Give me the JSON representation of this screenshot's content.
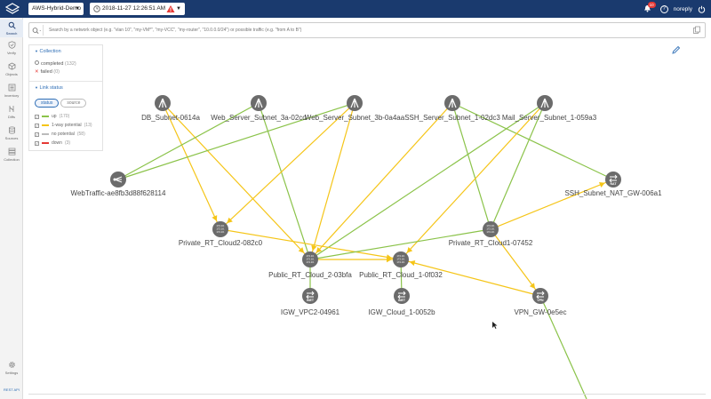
{
  "app": {
    "env_select": "AWS-Hybrid-Demo",
    "datetime": "2018-11-27 12:26:51 AM",
    "notifications": "10",
    "help": "?",
    "user": "noreply"
  },
  "sidebar": {
    "items": [
      {
        "label": "Search",
        "icon": "search-icon"
      },
      {
        "label": "Verify",
        "icon": "check-shield-icon"
      },
      {
        "label": "Objects",
        "icon": "cube-icon"
      },
      {
        "label": "Inventory",
        "icon": "list-icon"
      },
      {
        "label": "Diffs",
        "icon": "diff-icon"
      },
      {
        "label": "Sources",
        "icon": "database-icon"
      },
      {
        "label": "Collection",
        "icon": "collection-icon"
      },
      {
        "label": "Settings",
        "icon": "gear-icon"
      }
    ],
    "footer": "REST API"
  },
  "search": {
    "placeholder": "Search by a network object (e.g. \"vlan 10\", \"my-VM*\", \"my-VCC\", \"my-router\", \"10.0.0.0/24\") or possible traffic (e.g. \"from A to B\")"
  },
  "panel": {
    "collection_header": "Collection",
    "completed": "completed",
    "completed_count": "(132)",
    "failed": "failed",
    "failed_count": "(0)",
    "link_header": "Link status",
    "toggle_status": "status",
    "toggle_source": "source",
    "statuses": [
      {
        "label": "up",
        "count": "(170)",
        "color": "#8bc34a"
      },
      {
        "label": "1-way potential",
        "count": "(13)",
        "color": "#f5c518"
      },
      {
        "label": "no potential",
        "count": "(58)",
        "color": "#bbbbbb"
      },
      {
        "label": "down",
        "count": "(3)",
        "color": "#e53935"
      }
    ]
  },
  "topology": {
    "nodes": [
      {
        "id": "db",
        "label": "DB_Subnet-0614a",
        "type": "subnet"
      },
      {
        "id": "web3a",
        "label": "Web_Server_Subnet_3a-02cd",
        "type": "subnet"
      },
      {
        "id": "web3b",
        "label": "Web_Server_Subnet_3b-0a4aa",
        "type": "subnet"
      },
      {
        "id": "ssh",
        "label": "SSH_Server_Subnet_1-02dc3",
        "type": "subnet"
      },
      {
        "id": "mail",
        "label": "Mail_Server_Subnet_1-059a3",
        "type": "subnet"
      },
      {
        "id": "webtraffic",
        "label": "WebTraffic-ae8fb3d88f628114",
        "type": "traffic"
      },
      {
        "id": "sshnat",
        "label": "SSH_Subnet_NAT_GW-006a1",
        "type": "nat",
        "badge": "NAT"
      },
      {
        "id": "prt2",
        "label": "Private_RT_Cloud2-082c0",
        "type": "router"
      },
      {
        "id": "prt1",
        "label": "Private_RT_Cloud1-07452",
        "type": "router"
      },
      {
        "id": "pub2",
        "label": "Public_RT_Cloud_2-03bfa",
        "type": "router"
      },
      {
        "id": "pub1",
        "label": "Public_RT_Cloud_1-0f032",
        "type": "router"
      },
      {
        "id": "igw2",
        "label": "IGW_VPC2-04961",
        "type": "igw",
        "badge": "INET"
      },
      {
        "id": "igw1",
        "label": "IGW_Cloud_1-0052b",
        "type": "igw",
        "badge": "INET"
      },
      {
        "id": "vpn",
        "label": "VPN_GW-0e5ec",
        "type": "vpn",
        "badge": "VPN"
      }
    ],
    "router_text": [
      "172.16.",
      "172.16.",
      "172.16."
    ],
    "links": [
      {
        "from": "db",
        "to": "prt2",
        "status": "1-way potential"
      },
      {
        "from": "db",
        "to": "pub2",
        "status": "1-way potential"
      },
      {
        "from": "web3a",
        "to": "webtraffic",
        "status": "up"
      },
      {
        "from": "web3a",
        "to": "pub2",
        "status": "up"
      },
      {
        "from": "web3b",
        "to": "prt2",
        "status": "1-way potential"
      },
      {
        "from": "web3b",
        "to": "pub2",
        "status": "1-way potential"
      },
      {
        "from": "webtraffic",
        "to": "web3b",
        "status": "up"
      },
      {
        "from": "ssh",
        "to": "pub2",
        "status": "1-way potential"
      },
      {
        "from": "ssh",
        "to": "prt1",
        "status": "up"
      },
      {
        "from": "ssh",
        "to": "sshnat",
        "status": "up"
      },
      {
        "from": "mail",
        "to": "pub1",
        "status": "1-way potential"
      },
      {
        "from": "mail",
        "to": "pub2",
        "status": "up"
      },
      {
        "from": "mail",
        "to": "prt1",
        "status": "up"
      },
      {
        "from": "prt2",
        "to": "pub1",
        "status": "1-way potential"
      },
      {
        "from": "pub2",
        "to": "pub1",
        "status": "1-way potential"
      },
      {
        "from": "pub2",
        "to": "igw2",
        "status": "up"
      },
      {
        "from": "pub1",
        "to": "igw1",
        "status": "up"
      },
      {
        "from": "prt1",
        "to": "sshnat",
        "status": "1-way potential"
      },
      {
        "from": "prt1",
        "to": "vpn",
        "status": "1-way potential"
      },
      {
        "from": "prt1",
        "to": "pub2",
        "status": "up"
      },
      {
        "from": "vpn",
        "to": "pub1",
        "status": "1-way potential"
      },
      {
        "from": "vpn",
        "to": "offscreen",
        "status": "up"
      }
    ]
  },
  "colors": {
    "up": "#8bc34a",
    "oneway": "#f5c518",
    "node": "#6b6b6b",
    "accent": "#2d6db5",
    "header": "#1a3a6e"
  }
}
